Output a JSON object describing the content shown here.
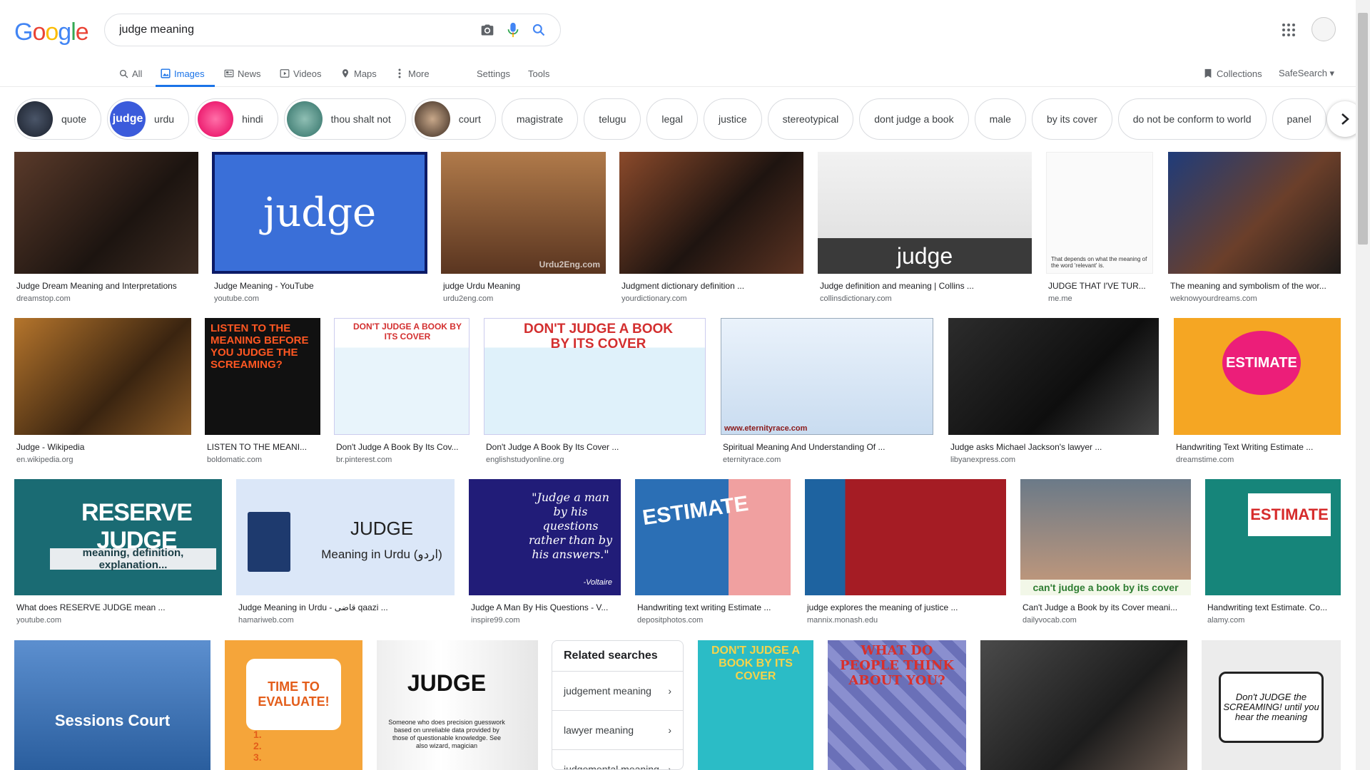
{
  "header": {
    "search_value": "judge meaning",
    "logo": "Google"
  },
  "tabs": [
    {
      "label": "All",
      "icon": "search-icon"
    },
    {
      "label": "Images",
      "icon": "image-icon"
    },
    {
      "label": "News",
      "icon": "news-icon"
    },
    {
      "label": "Videos",
      "icon": "video-icon"
    },
    {
      "label": "Maps",
      "icon": "map-pin-icon"
    },
    {
      "label": "More",
      "icon": "more-vert-icon"
    },
    {
      "label": "Settings"
    },
    {
      "label": "Tools"
    },
    {
      "label": "Collections",
      "icon": "bookmark-icon"
    },
    {
      "label": "SafeSearch ▾"
    }
  ],
  "chips": [
    "quote",
    "urdu",
    "hindi",
    "thou shalt not",
    "court",
    "magistrate",
    "telugu",
    "legal",
    "justice",
    "stereotypical",
    "dont judge a book",
    "male",
    "by its cover",
    "do not be conform to world",
    "panel"
  ],
  "row1": [
    {
      "title": "Judge Dream Meaning and Interpretations",
      "src": "dreamstop.com"
    },
    {
      "title": "Judge Meaning - YouTube",
      "src": "youtube.com",
      "overlay": "judge"
    },
    {
      "title": "judge Urdu Meaning",
      "src": "urdu2eng.com",
      "overlay": "Urdu2Eng.com"
    },
    {
      "title": "Judgment dictionary definition ...",
      "src": "yourdictionary.com"
    },
    {
      "title": "Judge definition and meaning | Collins ...",
      "src": "collinsdictionary.com",
      "overlay": "judge"
    },
    {
      "title": "JUDGE THAT I'VE TUR...",
      "src": "me.me",
      "overlay": "That depends on what the meaning of the word 'relevant' is."
    },
    {
      "title": "The meaning and symbolism of the wor...",
      "src": "weknowyourdreams.com"
    }
  ],
  "row2": [
    {
      "title": "Judge - Wikipedia",
      "src": "en.wikipedia.org"
    },
    {
      "title": "LISTEN TO THE MEANI...",
      "src": "boldomatic.com",
      "overlay": "LISTEN TO THE MEANING BEFORE YOU JUDGE THE SCREAMING?"
    },
    {
      "title": "Don't Judge A Book By Its Cov...",
      "src": "br.pinterest.com",
      "overlay": "DON'T JUDGE A BOOK BY ITS COVER"
    },
    {
      "title": "Don't Judge A Book By Its Cover ...",
      "src": "englishstudyonline.org",
      "overlay": "DON'T JUDGE A BOOK BY ITS COVER"
    },
    {
      "title": "Spiritual Meaning And Understanding Of ...",
      "src": "eternityrace.com",
      "overlay": "www.eternityrace.com"
    },
    {
      "title": "Judge asks Michael Jackson's lawyer ...",
      "src": "libyanexpress.com"
    },
    {
      "title": "Handwriting Text Writing Estimate ...",
      "src": "dreamstime.com",
      "overlay": "ESTIMATE"
    }
  ],
  "row3": [
    {
      "title": "What does RESERVE JUDGE mean ...",
      "src": "youtube.com",
      "overlay": "RESERVE JUDGE",
      "overlay2": "meaning, definition, explanation..."
    },
    {
      "title": "Judge Meaning in Urdu - قاضی qaazi ...",
      "src": "hamariweb.com",
      "overlay": "JUDGE",
      "overlay2": "Meaning in Urdu (اردو)"
    },
    {
      "title": "Judge A Man By His Questions - V...",
      "src": "inspire99.com",
      "overlay": "\"Judge a man by his questions rather than by his answers.\"",
      "overlay2": "-Voltaire"
    },
    {
      "title": "Handwriting text writing Estimate ...",
      "src": "depositphotos.com",
      "overlay": "ESTIMATE"
    },
    {
      "title": "judge explores the meaning of justice ...",
      "src": "mannix.monash.edu"
    },
    {
      "title": "Can't Judge a Book by its Cover meani...",
      "src": "dailyvocab.com",
      "overlay": "can't judge a book by its cover"
    },
    {
      "title": "Handwriting text Estimate. Co...",
      "src": "alamy.com",
      "overlay": "ESTIMATE"
    }
  ],
  "row4": [
    {
      "overlay": "Sessions Court"
    },
    {
      "overlay": "TIME TO EVALUATE!",
      "overlay2": "1.\n2.\n3."
    },
    {
      "overlay": "JUDGE",
      "overlay2": "Someone who does precision guesswork based on unreliable data provided by those of questionable knowledge. See also wizard, magician"
    },
    {
      "overlay": "DON'T JUDGE A BOOK BY ITS COVER"
    },
    {
      "overlay": "WHAT DO PEOPLE THINK ABOUT YOU?"
    },
    {},
    {
      "overlay": "Don't JUDGE the SCREAMING! until you hear the meaning"
    }
  ],
  "related": {
    "heading": "Related searches",
    "items": [
      "judgement meaning",
      "lawyer meaning",
      "judgemental meaning"
    ]
  }
}
